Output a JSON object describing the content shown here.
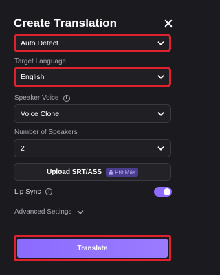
{
  "header": {
    "title": "Create Translation"
  },
  "source_language": {
    "value": "Auto Detect"
  },
  "target_language": {
    "label": "Target Language",
    "value": "English"
  },
  "speaker_voice": {
    "label": "Speaker Voice",
    "value": "Voice Clone"
  },
  "speakers": {
    "label": "Number of Speakers",
    "value": "2"
  },
  "upload": {
    "label": "Upload SRT/ASS",
    "badge": "Pro Max"
  },
  "lip_sync": {
    "label": "Lip Sync",
    "enabled": true
  },
  "advanced": {
    "label": "Advanced Settings"
  },
  "actions": {
    "translate_label": "Translate"
  },
  "colors": {
    "accent": "#8f6bff",
    "highlight": "#e0222e",
    "background": "#1b1b1f"
  }
}
